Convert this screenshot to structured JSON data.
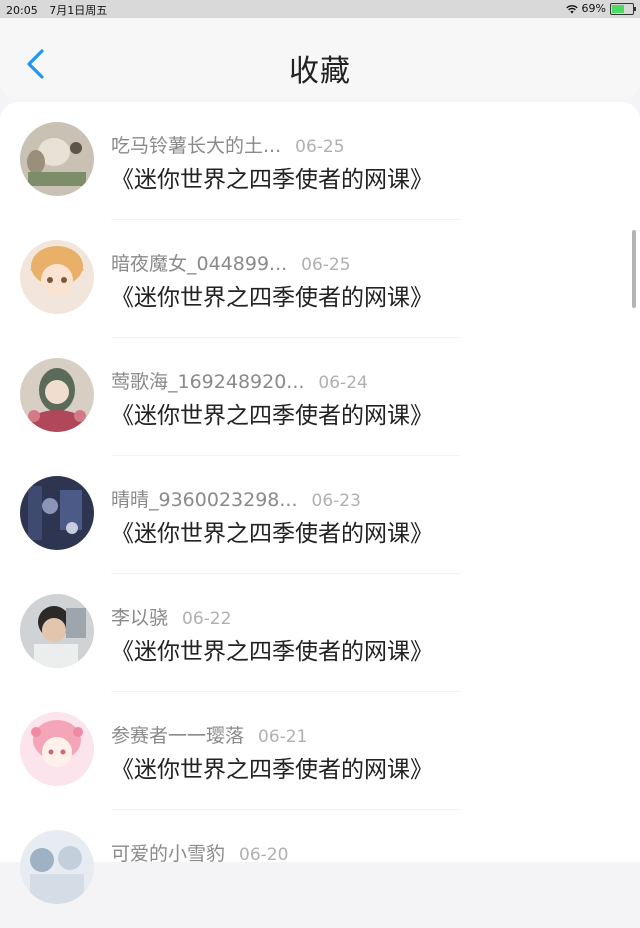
{
  "status_bar": {
    "time": "20:05",
    "date": "7月1日周五",
    "battery": "69%",
    "battery_level": 0.69
  },
  "header": {
    "title": "收藏",
    "back_icon": "chevron-left-icon"
  },
  "favorites": [
    {
      "user": "吃马铃薯长大的土...",
      "date": "06-25",
      "course": "《迷你世界之四季使者的网课》"
    },
    {
      "user": "暗夜魔女_044899...",
      "date": "06-25",
      "course": "《迷你世界之四季使者的网课》"
    },
    {
      "user": "莺歌海_169248920...",
      "date": "06-24",
      "course": "《迷你世界之四季使者的网课》"
    },
    {
      "user": "晴晴_9360023298...",
      "date": "06-23",
      "course": "《迷你世界之四季使者的网课》"
    },
    {
      "user": "李以骁",
      "date": "06-22",
      "course": "《迷你世界之四季使者的网课》"
    },
    {
      "user": "参赛者一一璎落",
      "date": "06-21",
      "course": "《迷你世界之四季使者的网课》"
    },
    {
      "user": "可爱的小雪豹",
      "date": "06-20",
      "course": ""
    }
  ],
  "colors": {
    "accent": "#2196f3",
    "battery": "#4cd964"
  }
}
